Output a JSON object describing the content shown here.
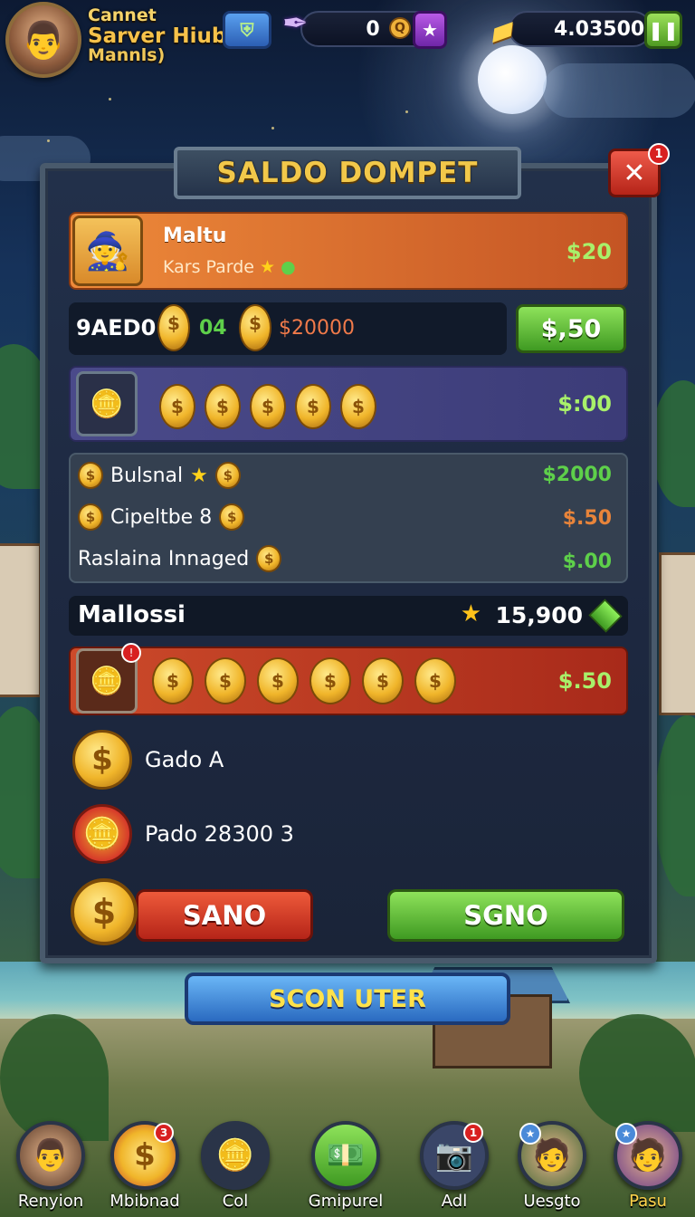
{
  "colors": {
    "gold": "#f2c84a",
    "green_value": "#a8f06a",
    "orange_value": "#f07a4a",
    "panel_bg": "#1d2840",
    "red_button": "#d23a22",
    "green_button": "#5fbf32",
    "blue_button": "#3f86d6"
  },
  "hud": {
    "player_line1": "Cannet",
    "player_line2": "Sarver Hiub",
    "player_line3": "Mannls)",
    "gem_count": "0",
    "gold_amount": "4.03500",
    "icons": [
      "avatar",
      "shield-icon",
      "feather-icon",
      "q-coin-icon",
      "purple-star-icon",
      "gold-bar-icon",
      "pause-icon"
    ]
  },
  "panel": {
    "title": "SALDO DOMPET",
    "close_badge": "1",
    "row1": {
      "name": "Maltu",
      "sub": "Kars Parde",
      "value": "$20"
    },
    "row2": {
      "label": "9AED0",
      "count": "04",
      "amount": "$20000",
      "button": "$,50"
    },
    "row3": {
      "value": "$:00"
    },
    "list": [
      {
        "label": "Bulsnal",
        "value": "$2000",
        "color": "#5ed04a"
      },
      {
        "label": "Cipeltbe 8",
        "value": "$.50",
        "color": "#e8843a"
      },
      {
        "label": "Raslaina Innaged",
        "value": "$.00",
        "color": "#5ed04a"
      }
    ],
    "summary": {
      "label": "Mallossi",
      "value": "15,900"
    },
    "row6": {
      "value": "$.50"
    },
    "items": [
      {
        "label": "Gado A"
      },
      {
        "label": "Pado 28300 3"
      }
    ],
    "btn_red": "SANO",
    "btn_green": "SGNO"
  },
  "main_button": "SCON UTER",
  "nav": [
    {
      "label": "Renyion",
      "icon": "hero-avatar-icon"
    },
    {
      "label": "Mbibnad",
      "icon": "coin-icon",
      "badge": "3"
    },
    {
      "label": "Col",
      "icon": "coin-stack-icon"
    },
    {
      "label": "Gmipurel",
      "icon": "cash-icon"
    },
    {
      "label": "Adl",
      "icon": "camera-icon",
      "badge": "1"
    },
    {
      "label": "Uesgto",
      "icon": "player-avatar-icon"
    },
    {
      "label": "Pasu",
      "icon": "player-avatar-icon"
    }
  ]
}
